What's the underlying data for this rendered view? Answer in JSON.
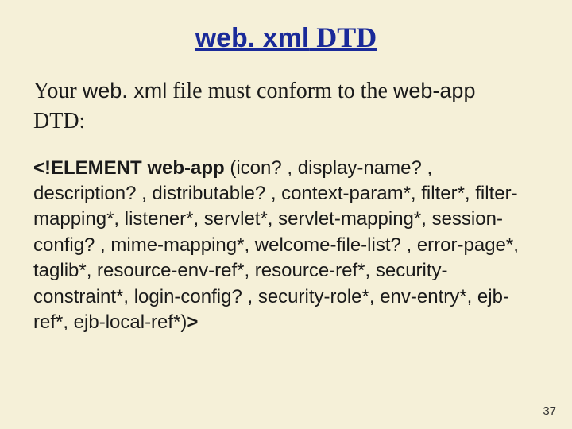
{
  "title": {
    "mono": "web. xml",
    "rest": " DTD"
  },
  "intro": {
    "t1": "Your ",
    "mono1": "web. xml",
    "t2": " file must conform to the ",
    "mono2": "web-app",
    "t3": "DTD:"
  },
  "dtd": {
    "bold_start": "<!ELEMENT web-app",
    "body": " (icon? , display-name? , description? , distributable? , context-param*, filter*, filter-mapping*, listener*, servlet*, servlet-mapping*, session-config? , mime-mapping*, welcome-file-list? , error-page*, taglib*, resource-env-ref*, resource-ref*, security-constraint*, login-config? , security-role*, env-entry*, ejb-ref*, ejb-local-ref*)",
    "bold_end": ">"
  },
  "page_number": "37"
}
